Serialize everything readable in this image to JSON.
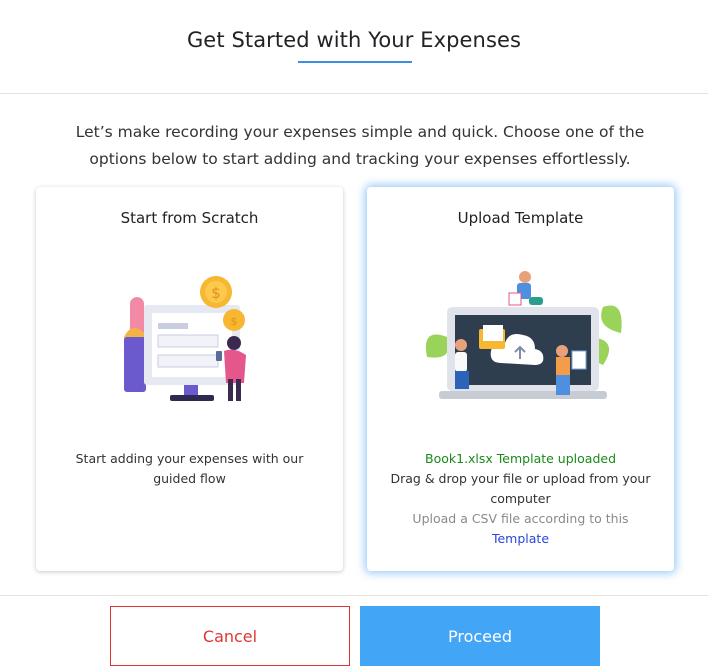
{
  "header": {
    "title": "Get Started with Your Expenses"
  },
  "intro": {
    "line1": "Let’s make recording your expenses simple and quick. Choose one of the",
    "line2": "options below to start adding and tracking your expenses effortlessly."
  },
  "options": {
    "scratch": {
      "title": "Start from Scratch",
      "description": "Start adding your expenses with our guided flow",
      "icon": "form-with-coins-illustration"
    },
    "upload": {
      "title": "Upload Template",
      "uploaded_status": "Book1.xlsx Template uploaded",
      "drag_text": "Drag & drop your file or upload from your computer",
      "hint_text": "Upload a CSV file according to this",
      "template_link": "Template",
      "icon": "laptop-upload-illustration",
      "selected": true
    }
  },
  "footer": {
    "cancel_label": "Cancel",
    "proceed_label": "Proceed"
  },
  "colors": {
    "accent": "#42a5f5",
    "cancel": "#e03535",
    "success": "#1a8a1a",
    "link": "#2a46d9"
  }
}
